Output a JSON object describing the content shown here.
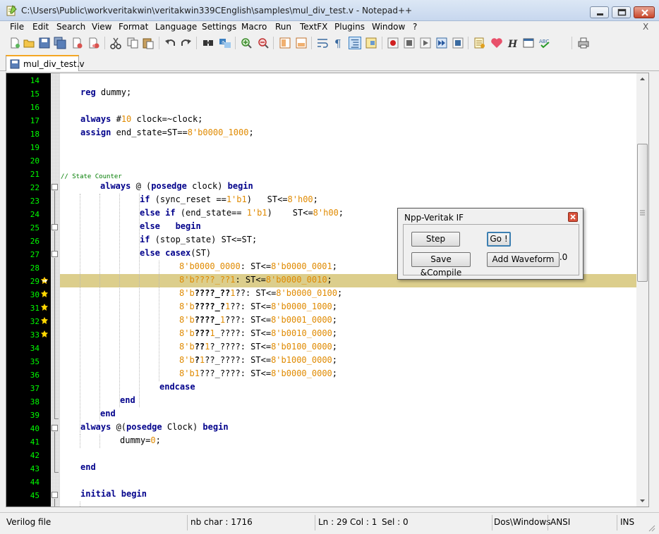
{
  "window": {
    "title": "C:\\Users\\Public\\workveritakwin\\veritakwin339CEnglish\\samples\\mul_div_test.v - Notepad++"
  },
  "menu": {
    "items": [
      "File",
      "Edit",
      "Search",
      "View",
      "Format",
      "Language",
      "Settings",
      "Macro",
      "Run",
      "TextFX",
      "Plugins",
      "Window",
      "?"
    ],
    "close_glyph": "X"
  },
  "tabs": [
    {
      "label": "mul_div_test.v",
      "active": true
    }
  ],
  "editor": {
    "lines": [
      {
        "n": "14"
      },
      {
        "n": "15"
      },
      {
        "n": "16"
      },
      {
        "n": "17"
      },
      {
        "n": "18"
      },
      {
        "n": "19"
      },
      {
        "n": "20"
      },
      {
        "n": "21"
      },
      {
        "n": "22"
      },
      {
        "n": "23"
      },
      {
        "n": "24"
      },
      {
        "n": "25"
      },
      {
        "n": "26"
      },
      {
        "n": "27"
      },
      {
        "n": "28"
      },
      {
        "n": "29"
      },
      {
        "n": "30"
      },
      {
        "n": "31"
      },
      {
        "n": "32"
      },
      {
        "n": "33"
      },
      {
        "n": "34"
      },
      {
        "n": "35"
      },
      {
        "n": "36"
      },
      {
        "n": "37"
      },
      {
        "n": "38"
      },
      {
        "n": "39"
      },
      {
        "n": "40"
      },
      {
        "n": "41"
      },
      {
        "n": "42"
      },
      {
        "n": "43"
      },
      {
        "n": "44"
      },
      {
        "n": "45"
      }
    ],
    "code": {
      "l15": {
        "kw": "reg",
        "rest": " dummy;"
      },
      "l17": {
        "kw": "always",
        "a": " #",
        "num": "10",
        "b": " clock=~clock;"
      },
      "l18": {
        "kw": "assign",
        "a": " end_state=ST==",
        "num": "8'b0000_1000",
        "b": ";"
      },
      "l21": {
        "comment": "// State Counter"
      },
      "l22": {
        "kw": "always",
        "a": " @ (",
        "kw2": "posedge",
        "b": " clock) ",
        "kw3": "begin"
      },
      "l23": {
        "kw": "if",
        "a": " (sync_reset ==",
        "num": "1'b1",
        "b": ")   ST<=",
        "num2": "8'h00",
        "c": ";"
      },
      "l24": {
        "kw": "else if",
        "a": " (end_state== ",
        "num": "1'b1",
        "b": ")    ST<=",
        "num2": "8'h00",
        "c": ";"
      },
      "l25": {
        "kw": "else   begin"
      },
      "l26": {
        "kw": "if",
        "a": " (stop_state) ST<=ST;"
      },
      "l27": {
        "kw": "else casex",
        "a": "(ST)"
      },
      "l28": {
        "num": "8'b0000_0000",
        "a": ": ST<=",
        "num2": "8'b0000_0001",
        "b": ";"
      },
      "l29": {
        "num": "8'b????_??1",
        "a": ": ST<=",
        "num2": "8'b0000_0010",
        "b": ";"
      },
      "l30": {
        "n1": "8'b",
        "q": "????_??",
        "n2": "1",
        "a": "??: ST<=",
        "num2": "8'b0000_0100",
        "b": ";"
      },
      "l31": {
        "n1": "8'b",
        "q": "????_?",
        "n2": "1",
        "a": "??: ST<=",
        "num2": "8'b0000_1000",
        "b": ";"
      },
      "l32": {
        "n1": "8'b",
        "q": "????_",
        "n2": "1",
        "a": "???: ST<=",
        "num2": "8'b0001_0000",
        "b": ";"
      },
      "l33": {
        "n1": "8'b",
        "q": "???",
        "n2": "1",
        "a": "_????: ST<=",
        "num2": "8'b0010_0000",
        "b": ";"
      },
      "l34": {
        "n1": "8'b",
        "q": "??",
        "n2": "1",
        "a": "?_????: ST<=",
        "num2": "8'b0100_0000",
        "b": ";"
      },
      "l35": {
        "n1": "8'b",
        "q": "?",
        "n2": "1",
        "a": "??_????: ST<=",
        "num2": "8'b1000_0000",
        "b": ";"
      },
      "l36": {
        "n1": "8'b",
        "q": "",
        "n2": "1",
        "a": "???_????: ST<=",
        "num2": "8'b0000_0000",
        "b": ";"
      },
      "l37": {
        "kw": "endcase"
      },
      "l38": {
        "kw": "end"
      },
      "l39": {
        "kw": "end"
      },
      "l40": {
        "kw": "always",
        "a": " @(",
        "kw2": "posedge",
        "b": " Clock) ",
        "kw3": "begin"
      },
      "l41": {
        "rest": "dummy=",
        "num": "0",
        "b": ";"
      },
      "l43": {
        "kw": "end"
      },
      "l45": {
        "kw": "initial begin"
      }
    }
  },
  "dialog": {
    "title": "Npp-Veritak IF",
    "step": "Step",
    "go": "Go !",
    "version": "ver 1.0",
    "save_compile": "Save &Compile",
    "add_waveform": "Add Waveform"
  },
  "status": {
    "file_type": "Verilog file",
    "nb_char": "nb char : 1716",
    "ln": "Ln : 29",
    "col": "Col : 1",
    "sel": "Sel : 0",
    "eol": "Dos\\Windows",
    "encoding": "ANSI",
    "mode": "INS"
  },
  "colors": {
    "line_number": "#00ff00",
    "margin_bg": "#000000",
    "keyword": "#00008b",
    "number": "#e08a00",
    "comment": "#007c00",
    "current_line": "#dcce8c"
  },
  "icons": [
    "new-file-icon",
    "open-file-icon",
    "save-icon",
    "save-all-icon",
    "close-icon",
    "close-all-icon",
    "cut-icon",
    "copy-icon",
    "paste-icon",
    "undo-icon",
    "redo-icon",
    "find-icon",
    "replace-icon",
    "zoom-in-icon",
    "zoom-out-icon",
    "sync-v-icon",
    "sync-h-icon",
    "wrap-icon",
    "show-all-chars-icon",
    "indent-guide-icon",
    "doc-map-icon",
    "record-macro-icon",
    "stop-record-icon",
    "play-macro-icon",
    "run-macro-multiple-icon",
    "save-macro-icon",
    "doc-list-icon",
    "heart-icon",
    "h-icon",
    "console-icon",
    "spell-check-icon",
    "print-icon"
  ]
}
